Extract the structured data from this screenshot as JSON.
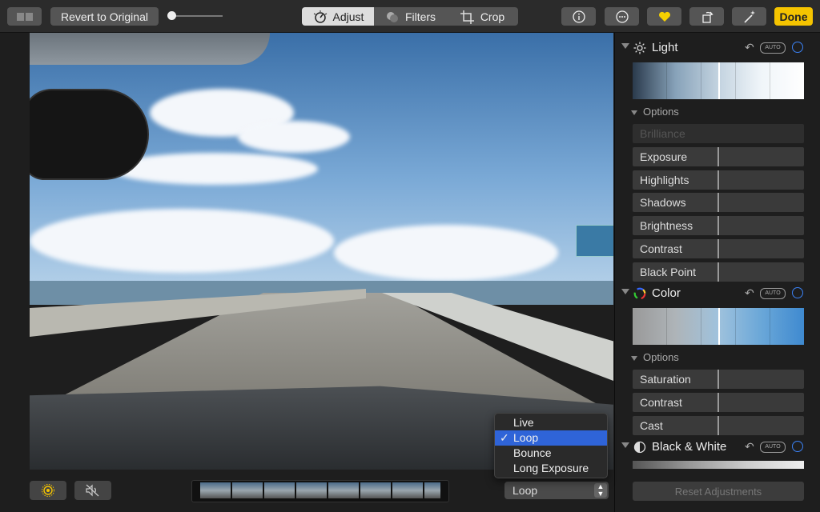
{
  "toolbar": {
    "revert_label": "Revert to Original",
    "tabs": [
      {
        "label": "Adjust",
        "icon": "adjust-dial-icon"
      },
      {
        "label": "Filters",
        "icon": "filters-circles-icon"
      },
      {
        "label": "Crop",
        "icon": "crop-icon"
      }
    ],
    "active_tab": "Adjust",
    "done_label": "Done",
    "accent": "#f5c400"
  },
  "sidebar": {
    "light": {
      "title": "Light",
      "auto_label": "AUTO",
      "options_label": "Options",
      "params": [
        "Brilliance",
        "Exposure",
        "Highlights",
        "Shadows",
        "Brightness",
        "Contrast",
        "Black Point"
      ]
    },
    "color": {
      "title": "Color",
      "auto_label": "AUTO",
      "options_label": "Options",
      "params": [
        "Saturation",
        "Contrast",
        "Cast"
      ]
    },
    "bw": {
      "title": "Black & White",
      "auto_label": "AUTO"
    },
    "reset_label": "Reset Adjustments"
  },
  "live_photo": {
    "selected": "Loop",
    "menu": [
      "Live",
      "Loop",
      "Bounce",
      "Long Exposure"
    ]
  }
}
